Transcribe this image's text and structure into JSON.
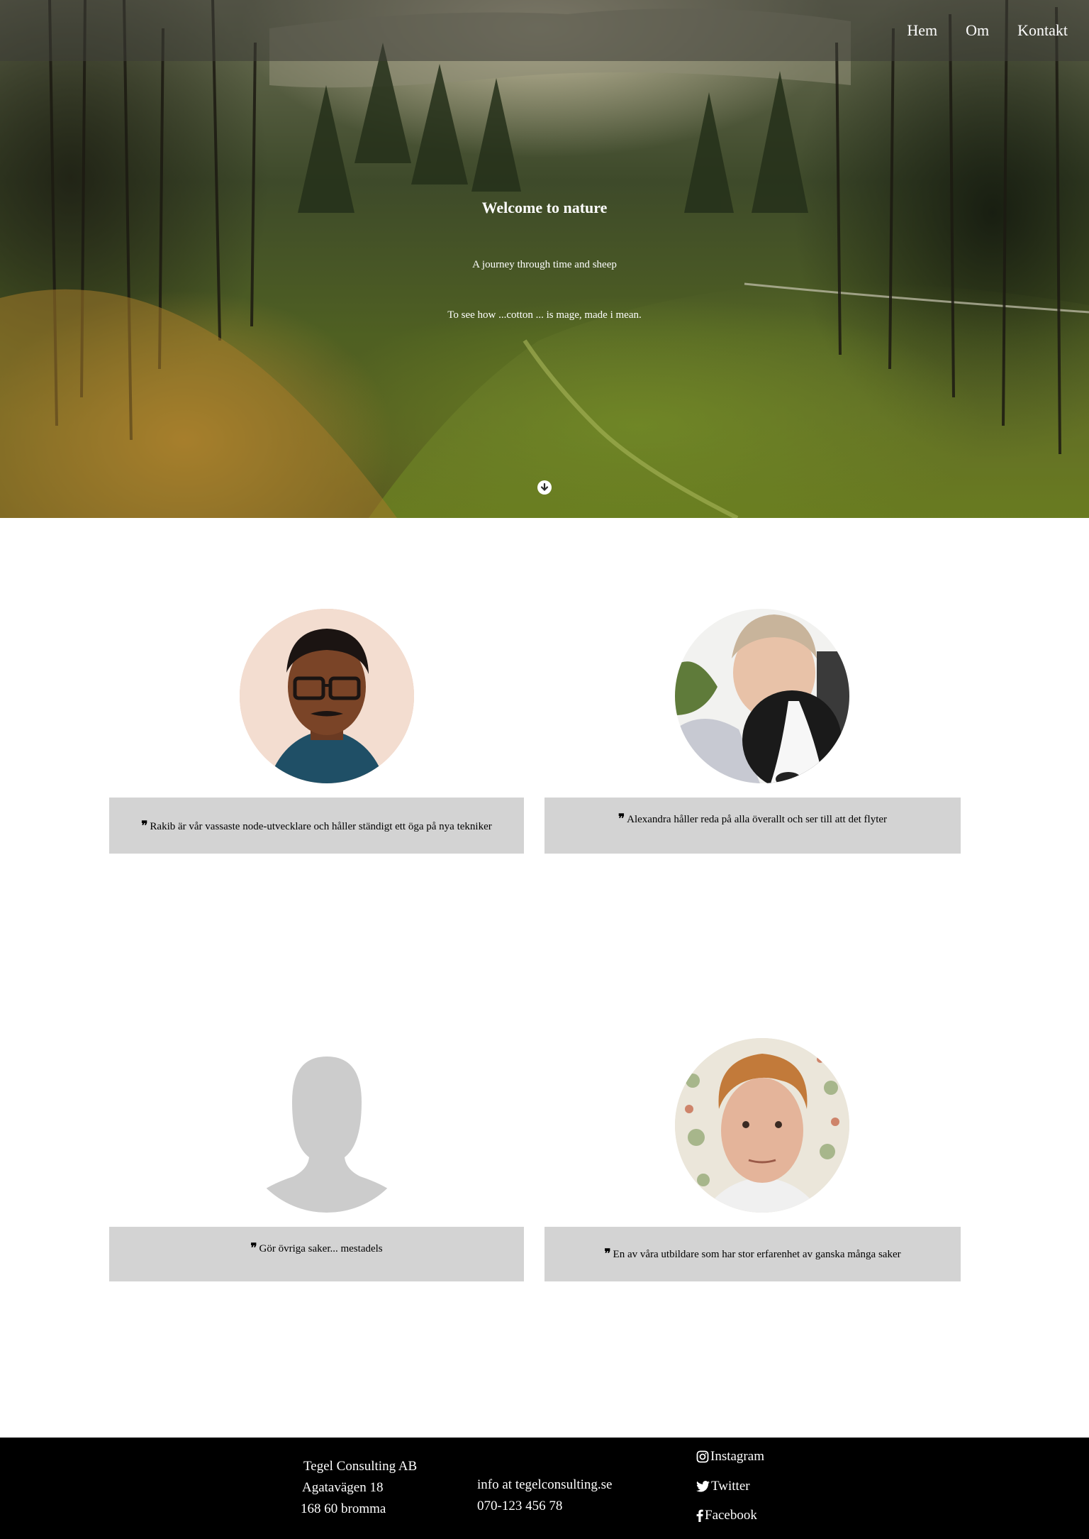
{
  "nav": {
    "items": [
      {
        "label": "Hem"
      },
      {
        "label": "Om"
      },
      {
        "label": "Kontakt"
      }
    ]
  },
  "hero": {
    "title": "Welcome to nature",
    "subtitle": "A journey through time and sheep",
    "description": "To see how ...cotton ... is mage, made i mean."
  },
  "team": [
    {
      "quote": "Rakib är vår vassaste node-utvecklare och håller ständigt ett öga på nya tekniker",
      "avatar_icon": "person-photo-icon"
    },
    {
      "quote": "Alexandra håller reda på alla överallt och ser till att det flyter",
      "avatar_icon": "person-with-dog-photo-icon"
    },
    {
      "quote": "Gör övriga saker... mestadels",
      "avatar_icon": "default-avatar-icon"
    },
    {
      "quote": "En av våra utbildare som har stor erfarenhet av ganska många saker",
      "avatar_icon": "person-photo-icon"
    }
  ],
  "footer": {
    "company": "Tegel Consulting AB",
    "street": "Agatavägen 18",
    "postal": "168 60 bromma",
    "email": "info at tegelconsulting.se",
    "phone": "070-123 456 78",
    "social": [
      {
        "label": "Instagram",
        "icon": "instagram-icon"
      },
      {
        "label": "Twitter",
        "icon": "twitter-icon"
      },
      {
        "label": "Facebook",
        "icon": "facebook-icon"
      }
    ]
  },
  "colors": {
    "quote_bg": "#d3d3d3",
    "footer_bg": "#000000",
    "placeholder_avatar": "#cccccc"
  }
}
